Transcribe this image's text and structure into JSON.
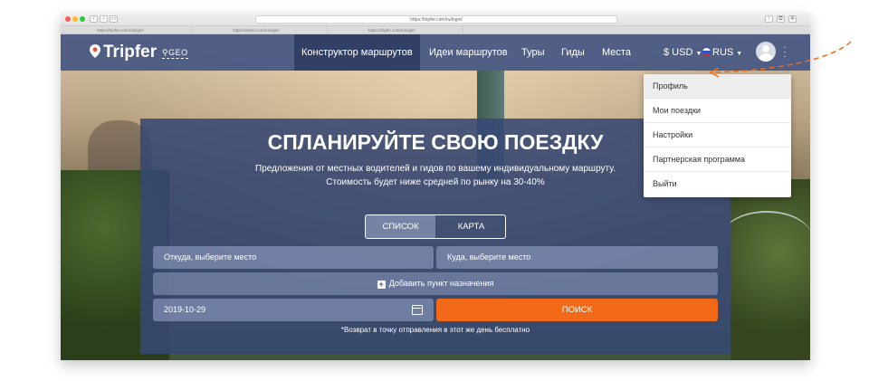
{
  "browser": {
    "address": "https://tripfer.com/ru/login/",
    "tabs": [
      "https://tripfer.com/ru/login/",
      "https://tripfer.com/ru/login/",
      "https://tripfer.com/ru/login/"
    ]
  },
  "nav": {
    "logo": "Tripfer",
    "region": "GEO",
    "items": [
      "Конструктор маршрутов",
      "Идеи маршрутов",
      "Туры",
      "Гиды",
      "Места"
    ],
    "currency": "$ USD",
    "language": "RUS"
  },
  "hero": {
    "title": "СПЛАНИРУЙТЕ СВОЮ ПОЕЗДКУ",
    "subtitle_line1": "Предложения от местных водителей и гидов по вашему индивидуальному маршруту.",
    "subtitle_line2": "Стоимость будет ниже средней по рынку на 30-40%"
  },
  "view_toggle": {
    "list": "СПИСОК",
    "map": "КАРТА"
  },
  "form": {
    "from_placeholder": "Откуда, выберите место",
    "to_placeholder": "Куда, выберите место",
    "add_destination": "Добавить пункт назначения",
    "date": "2019-10-29",
    "search": "ПОИСК",
    "note": "*Возврат в точку отправления в этот же день бесплатно"
  },
  "user_menu": [
    "Профиль",
    "Мои поездки",
    "Настройки",
    "Партнерская программа",
    "Выйти"
  ],
  "colors": {
    "nav": "#465682",
    "accent": "#f26a17",
    "panel": "#374873"
  }
}
